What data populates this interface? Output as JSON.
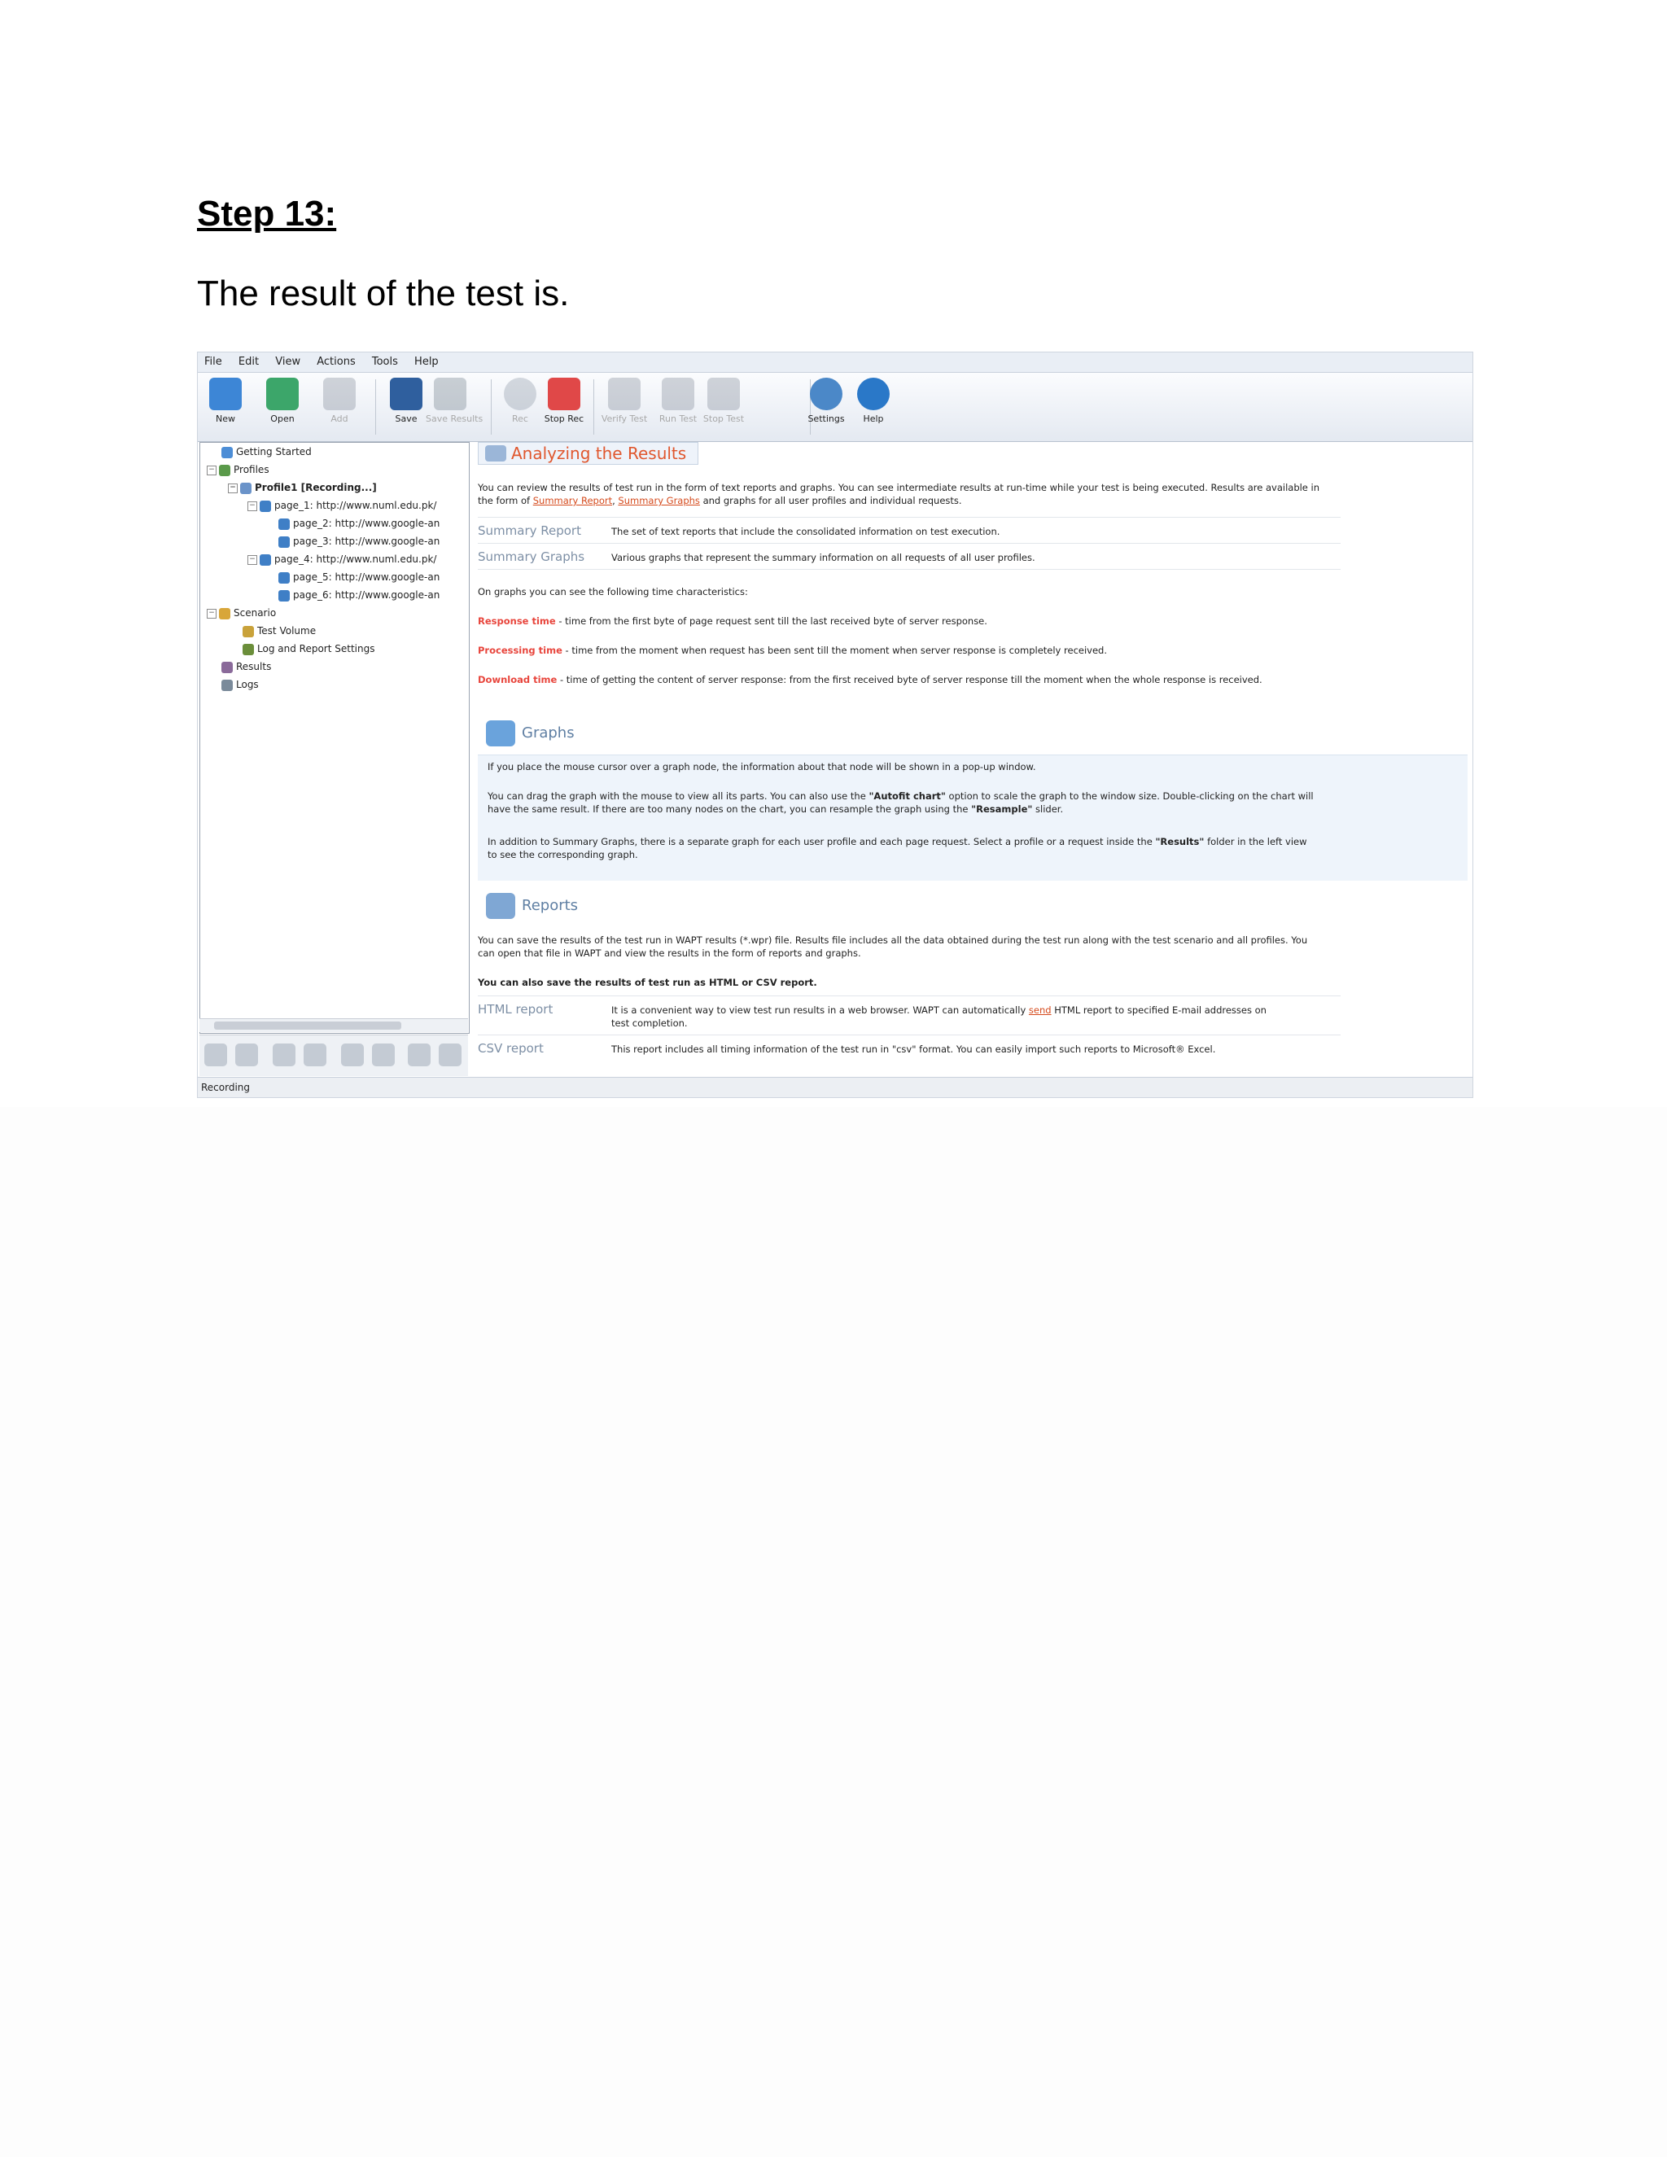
{
  "document": {
    "heading": "Step 13:",
    "intro": "The result of the test is."
  },
  "app": {
    "menu": [
      "File",
      "Edit",
      "View",
      "Actions",
      "Tools",
      "Help"
    ],
    "toolbar": [
      {
        "label": "New",
        "icon": "new-icon",
        "enabled": true
      },
      {
        "label": "Open",
        "icon": "open-icon",
        "enabled": true
      },
      {
        "label": "Add",
        "icon": "add-icon",
        "enabled": false
      },
      {
        "label": "Save",
        "icon": "save-icon",
        "enabled": true
      },
      {
        "label": "Save Results",
        "icon": "save-results-icon",
        "enabled": false
      },
      {
        "label": "Rec",
        "icon": "record-icon",
        "enabled": false
      },
      {
        "label": "Stop Rec",
        "icon": "stop-record-icon",
        "enabled": true
      },
      {
        "label": "Verify Test",
        "icon": "verify-test-icon",
        "enabled": false
      },
      {
        "label": "Run Test",
        "icon": "run-test-icon",
        "enabled": false
      },
      {
        "label": "Stop Test",
        "icon": "stop-test-icon",
        "enabled": false
      },
      {
        "label": "Settings",
        "icon": "settings-icon",
        "enabled": true
      },
      {
        "label": "Help",
        "icon": "help-icon",
        "enabled": true
      }
    ],
    "tree": [
      "Getting Started",
      "Profiles",
      "Profile1 [Recording...]",
      "page_1: http://www.numl.edu.pk/",
      "page_2: http://www.google-an",
      "page_3: http://www.google-an",
      "page_4: http://www.numl.edu.pk/",
      "page_5: http://www.google-an",
      "page_6: http://www.google-an",
      "Scenario",
      "Test Volume",
      "Log and Report Settings",
      "Results",
      "Logs"
    ],
    "status": "Recording"
  },
  "content": {
    "title": "Analyzing the Results",
    "intro_a": "You can review the results of test run in the form of text reports and graphs. You can see intermediate results at run-time while your test is being executed. Results are available in",
    "intro_b": "the form of",
    "link_summary_report": "Summary Report",
    "link_summary_graphs": "Summary Graphs",
    "intro_c": "and graphs for all user profiles and individual requests.",
    "summary_report_label": "Summary Report",
    "summary_report_text": "The set of text reports that include the consolidated information on test execution.",
    "summary_graphs_label": "Summary Graphs",
    "summary_graphs_text": "Various graphs that represent the summary information on all requests of all user profiles.",
    "time_intro": "On graphs you can see the following time characteristics:",
    "response_label": "Response time",
    "response_text": " - time from the first byte of page request sent till the last received byte of server response.",
    "processing_label": "Processing time",
    "processing_text": " - time from the moment when request has been sent till the moment when server response is completely received.",
    "download_label": "Download time",
    "download_text": " - time of getting the content of server response: from the first received byte of server response till the moment when the whole response is received.",
    "graphs_heading": "Graphs",
    "graphs_p1": "If you place the mouse cursor over a graph node, the information about that node will be shown in a pop-up window.",
    "graphs_p2a": "You can drag the graph with the mouse to view all its parts. You can also use the",
    "graphs_autofit": "\"Autofit chart\"",
    "graphs_p2b": "option to scale the graph to the window size. Double-clicking on the chart will",
    "graphs_p2c": "have the same result. If there are too many nodes on the chart, you can resample the graph using the",
    "graphs_resample": "\"Resample\"",
    "graphs_p2d": "slider.",
    "graphs_p3a": "In addition to Summary Graphs, there is a separate graph for each user profile and each page request. Select a profile or a request inside the",
    "graphs_results": "\"Results\"",
    "graphs_p3b": "folder in the left view",
    "graphs_p3c": "to see the corresponding graph.",
    "reports_heading": "Reports",
    "reports_p1a": "You can save the results of the test run in WAPT results (*.wpr) file. Results file includes all the data obtained during the test run along with the test scenario and all profiles. You",
    "reports_p1b": "can open that file in WAPT and view the results in the form of reports and graphs.",
    "reports_bold": "You can also save the results of test run as HTML or CSV report.",
    "html_label": "HTML report",
    "html_text_a": "It is a convenient way to view test run results in a web browser. WAPT can automatically",
    "html_link": "send",
    "html_text_b": "HTML report to specified E-mail addresses on",
    "html_text_c": "test completion.",
    "csv_label": "CSV report",
    "csv_text": "This report includes all timing information of the test run in \"csv\" format. You can easily import such reports to Microsoft® Excel."
  },
  "colors": {
    "accent_red": "#e8453c",
    "section_blue": "#5f7fa3",
    "title_orange": "#e0572e"
  }
}
